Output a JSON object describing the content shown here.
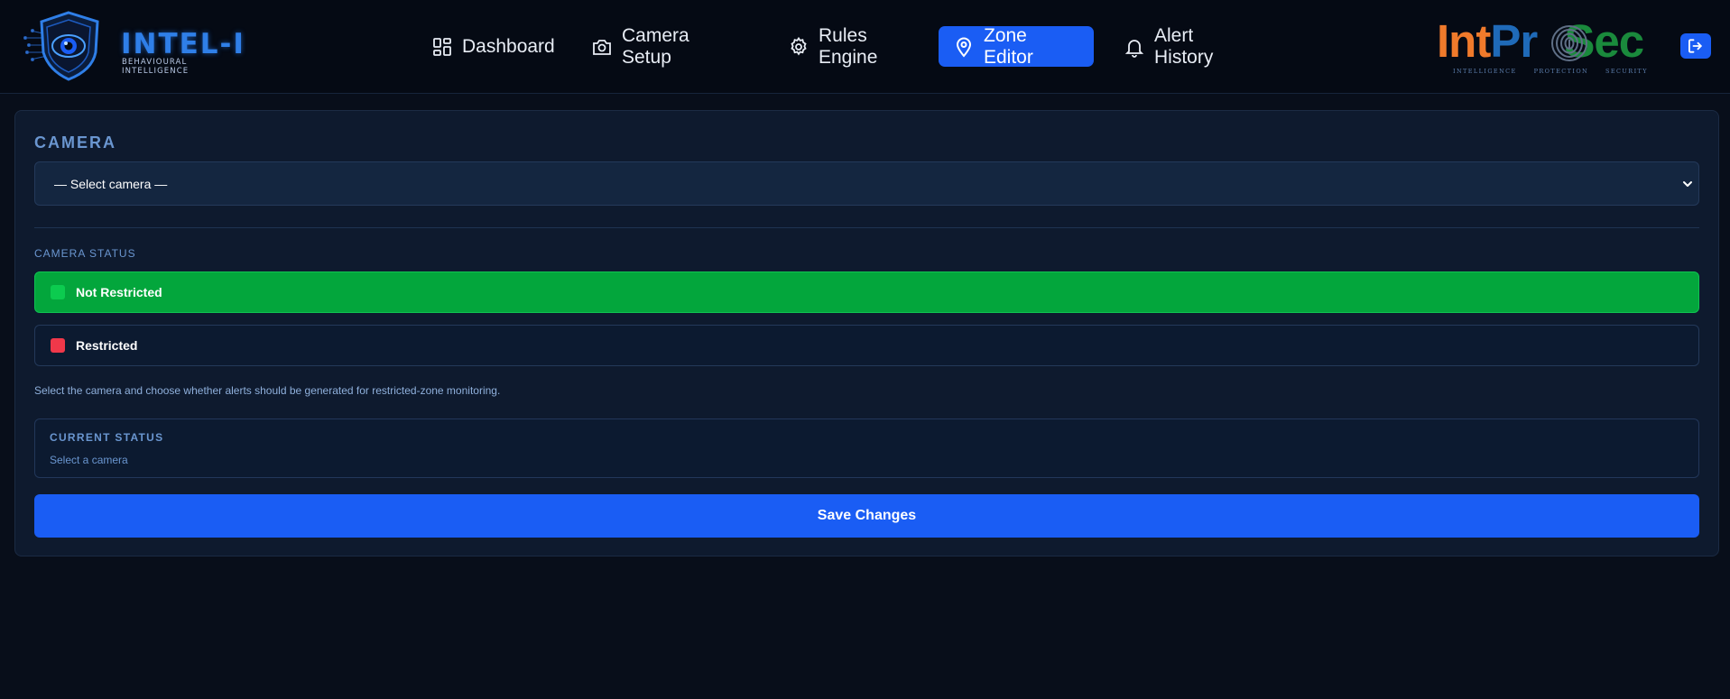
{
  "brand": {
    "name": "INTEL-I",
    "tagline": "BEHAVIOURAL INTELLIGENCE",
    "partner_logo": {
      "int": "Int",
      "pr": "Pr",
      "o": "o",
      "sec": "Sec",
      "sub": [
        "INTELLIGENCE",
        "PROTECTION",
        "SECURITY"
      ]
    }
  },
  "nav": {
    "items": [
      {
        "label": "Dashboard",
        "icon": "grid-icon"
      },
      {
        "label": "Camera Setup",
        "icon": "camera-icon"
      },
      {
        "label": "Rules Engine",
        "icon": "gear-icon"
      },
      {
        "label": "Zone Editor",
        "icon": "map-pin-icon",
        "active": true
      },
      {
        "label": "Alert History",
        "icon": "bell-icon"
      }
    ],
    "logout_icon": "logout-icon"
  },
  "camera": {
    "section_title": "CAMERA",
    "select_value": "— Select camera —"
  },
  "camera_status": {
    "label": "CAMERA STATUS",
    "options": [
      {
        "label": "Not Restricted",
        "selected": true,
        "color": "#03a63c"
      },
      {
        "label": "Restricted",
        "selected": false,
        "color": "#f0384a"
      }
    ],
    "help": "Select the camera and choose whether alerts should be generated for restricted-zone monitoring."
  },
  "current_status": {
    "title": "CURRENT STATUS",
    "value": "Select a camera"
  },
  "actions": {
    "save_label": "Save Changes"
  },
  "colors": {
    "accent": "#1a5df4",
    "background": "#080e1a",
    "panel": "#0e1a2e"
  }
}
